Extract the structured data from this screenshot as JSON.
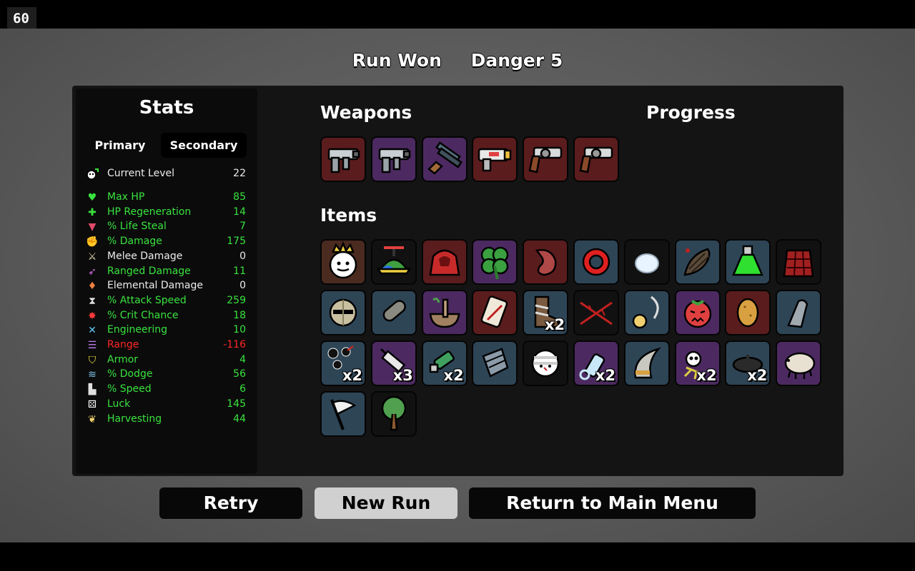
{
  "fps": "60",
  "header": {
    "result": "Run Won",
    "danger": "Danger 5"
  },
  "stats": {
    "title": "Stats",
    "tabs": {
      "primary": "Primary",
      "secondary": "Secondary"
    },
    "current_level": {
      "label": "Current Level",
      "value": "22"
    },
    "rows": [
      {
        "icon": "heart-icon",
        "label": "Max HP",
        "value": "85",
        "color": "#39e33f"
      },
      {
        "icon": "heart-plus-icon",
        "label": "HP Regeneration",
        "value": "14",
        "color": "#39e33f"
      },
      {
        "icon": "fang-icon",
        "label": "% Life Steal",
        "value": "7",
        "color": "#39e33f"
      },
      {
        "icon": "muscle-icon",
        "label": "% Damage",
        "value": "175",
        "color": "#39e33f"
      },
      {
        "icon": "sword-icon",
        "label": "Melee Damage",
        "value": "0",
        "color": "#ececec"
      },
      {
        "icon": "bow-icon",
        "label": "Ranged Damage",
        "value": "11",
        "color": "#39e33f"
      },
      {
        "icon": "flame-icon",
        "label": "Elemental Damage",
        "value": "0",
        "color": "#ececec"
      },
      {
        "icon": "hourglass-icon",
        "label": "% Attack Speed",
        "value": "259",
        "color": "#39e33f"
      },
      {
        "icon": "crit-burst-icon",
        "label": "% Crit Chance",
        "value": "18",
        "color": "#39e33f"
      },
      {
        "icon": "wrench-icon",
        "label": "Engineering",
        "value": "10",
        "color": "#39e33f"
      },
      {
        "icon": "range-wave-icon",
        "label": "Range",
        "value": "-116",
        "color": "#ff2626"
      },
      {
        "icon": "shield-icon",
        "label": "Armor",
        "value": "4",
        "color": "#39e33f"
      },
      {
        "icon": "dodge-wind-icon",
        "label": "% Dodge",
        "value": "56",
        "color": "#39e33f"
      },
      {
        "icon": "boot-icon",
        "label": "% Speed",
        "value": "6",
        "color": "#39e33f"
      },
      {
        "icon": "dice-icon",
        "label": "Luck",
        "value": "145",
        "color": "#39e33f"
      },
      {
        "icon": "wheat-icon",
        "label": "Harvesting",
        "value": "44",
        "color": "#39e33f"
      }
    ]
  },
  "weapons": {
    "title": "Weapons",
    "items": [
      {
        "name": "smg-weapon-icon",
        "tier": "red"
      },
      {
        "name": "smg-weapon-icon",
        "tier": "purple"
      },
      {
        "name": "double-barrel-shotgun-icon",
        "tier": "purple"
      },
      {
        "name": "laser-gun-icon",
        "tier": "red"
      },
      {
        "name": "revolver-icon",
        "tier": "red"
      },
      {
        "name": "revolver-icon",
        "tier": "red"
      }
    ]
  },
  "progress": {
    "title": "Progress"
  },
  "items": {
    "title": "Items",
    "rows": [
      [
        {
          "name": "king-face-icon",
          "qty": ""
        },
        {
          "name": "propeller-hat-icon",
          "qty": ""
        },
        {
          "name": "red-hoodie-icon",
          "qty": ""
        },
        {
          "name": "four-leaf-clover-icon",
          "qty": ""
        },
        {
          "name": "stomach-icon",
          "qty": ""
        },
        {
          "name": "red-ring-icon",
          "qty": ""
        },
        {
          "name": "white-egg-icon",
          "qty": ""
        },
        {
          "name": "leech-icon",
          "qty": ""
        },
        {
          "name": "green-potion-icon",
          "qty": ""
        },
        {
          "name": "plaid-jacket-icon",
          "qty": ""
        }
      ],
      [
        {
          "name": "knight-helmet-icon",
          "qty": ""
        },
        {
          "name": "cast-arm-icon",
          "qty": ""
        },
        {
          "name": "mortar-pestle-icon",
          "qty": ""
        },
        {
          "name": "scroll-icon",
          "qty": ""
        },
        {
          "name": "bandaged-boot-icon",
          "qty": "x2"
        },
        {
          "name": "barbed-wire-icon",
          "qty": ""
        },
        {
          "name": "pendant-icon",
          "qty": ""
        },
        {
          "name": "angry-tomato-icon",
          "qty": ""
        },
        {
          "name": "potato-icon",
          "qty": ""
        },
        {
          "name": "bullet-icon",
          "qty": ""
        }
      ],
      [
        {
          "name": "black-blobs-icon",
          "qty": "x2"
        },
        {
          "name": "syringe-icon",
          "qty": "x3"
        },
        {
          "name": "green-cartridge-icon",
          "qty": "x2"
        },
        {
          "name": "metal-glove-icon",
          "qty": ""
        },
        {
          "name": "bandaged-face-icon",
          "qty": ""
        },
        {
          "name": "baby-bottle-icon",
          "qty": "x2"
        },
        {
          "name": "crescent-blade-icon",
          "qty": ""
        },
        {
          "name": "skull-critter-icon",
          "qty": "x2"
        },
        {
          "name": "dark-beret-icon",
          "qty": "x2"
        },
        {
          "name": "tardigrade-icon",
          "qty": ""
        }
      ],
      [
        {
          "name": "white-flag-icon",
          "qty": ""
        },
        {
          "name": "tree-icon",
          "qty": ""
        }
      ]
    ]
  },
  "buttons": {
    "retry": "Retry",
    "new_run": "New Run",
    "main_menu": "Return to Main Menu"
  },
  "colors": {
    "stat_green": "#39e33f",
    "stat_red": "#ff2626",
    "tier_red": "#5a1c1d",
    "tier_purple": "#4c2a61",
    "tier_blue": "#2e4556",
    "tier_dark": "#111111"
  }
}
